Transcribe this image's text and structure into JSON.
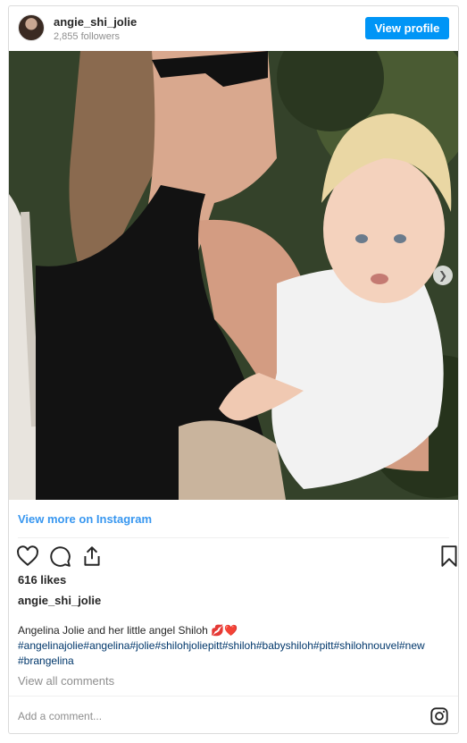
{
  "header": {
    "username": "angie_shi_jolie",
    "followers": "2,855 followers",
    "view_profile_label": "View profile"
  },
  "post": {
    "view_more_label": "View more on Instagram",
    "likes": "616 likes",
    "owner": "angie_shi_jolie",
    "caption": "Angelina Jolie and her little angel Shiloh",
    "caption_emoji": "💋❤️",
    "hashtags_line1": "#angelinajolie#angelina#jolie#shilohjoliepitt#shiloh#babyshiloh#pitt#shilohnouvel#new",
    "hashtags_line2": "#brangelina",
    "view_comments_label": "View all comments",
    "comment_placeholder": "Add a comment...",
    "carousel": {
      "current": 1,
      "total": 2
    }
  },
  "icons": {
    "like": "heart-icon",
    "comment": "comment-icon",
    "share": "share-icon",
    "save": "bookmark-icon",
    "instagram": "instagram-icon",
    "next": "chevron-right-icon"
  },
  "colors": {
    "accent": "#0095f6",
    "link": "#3897f0",
    "hashtag": "#00376b",
    "muted": "#8e8e8e"
  }
}
